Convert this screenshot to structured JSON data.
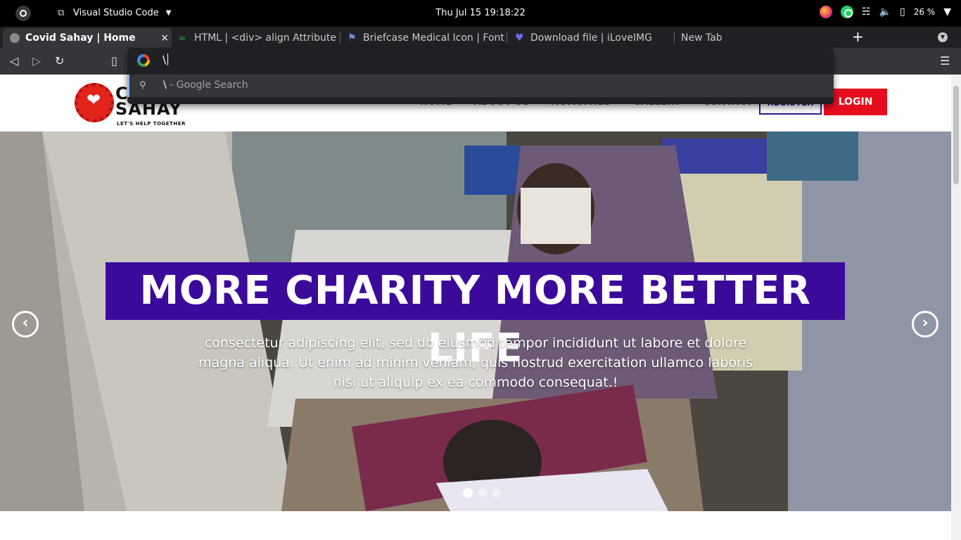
{
  "os": {
    "app_name": "Visual Studio Code",
    "clock": "Thu Jul 15  19:18:22",
    "battery": "26 %"
  },
  "browser": {
    "tabs": [
      {
        "title": "Covid Sahay | Home",
        "active": true
      },
      {
        "title": "HTML | <div> align Attribute -",
        "active": false
      },
      {
        "title": "Briefcase Medical Icon | Font /",
        "active": false
      },
      {
        "title": "Download file | iLoveIMG",
        "active": false
      },
      {
        "title": "New Tab",
        "active": false
      }
    ],
    "close_glyph": "×",
    "new_tab_glyph": "+",
    "omnibox": {
      "value": "\\",
      "suggestion_query": "\\",
      "suggestion_suffix": " - Google Search"
    }
  },
  "site": {
    "logo_text_line1": "C",
    "logo_text_line2": "SAHAY",
    "logo_tagline": "LET'S HELP TOGETHER",
    "nav": [
      "HOME",
      "ABOUT US",
      "ACTIVITIES",
      "GALLERY",
      "CONTACT US"
    ],
    "register_label": "REGISTER",
    "login_label": "LOGIN",
    "hero": {
      "title": "MORE CHARITY MORE BETTER LIFE",
      "text": "consectetur adipiscing elit, sed do eiusmod tempor incididunt ut labore et dolore magna aliqua. Ut enim ad minim veniam, quis nostrud exercitation ullamco laboris nisi ut aliquip ex ea commodo consequat.!",
      "prev_glyph": "‹",
      "next_glyph": "›",
      "slide_count": 3,
      "active_slide": 1
    }
  },
  "colors": {
    "hero_title_bg": "#3b0a9a",
    "login_bg": "#e60e1e",
    "register_border": "#2e1a9a"
  }
}
